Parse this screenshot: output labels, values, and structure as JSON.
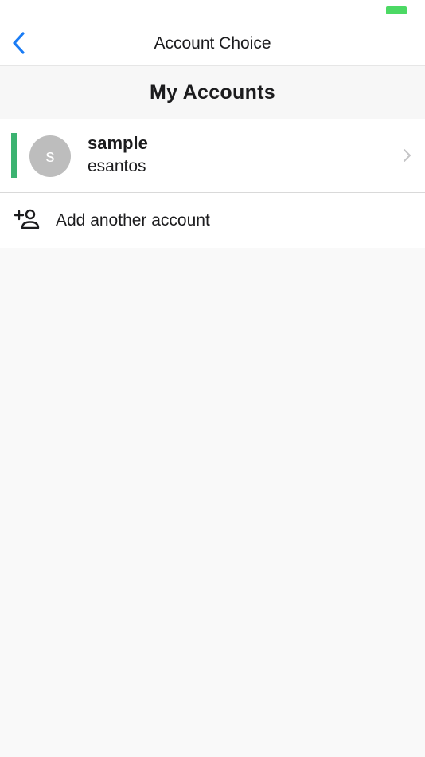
{
  "colors": {
    "accent": "#1a7cf5",
    "active_indicator": "#3cb371",
    "battery": "#4cd964"
  },
  "nav": {
    "title": "Account Choice",
    "back_icon": "chevron-left-icon"
  },
  "section": {
    "title": "My Accounts"
  },
  "accounts": [
    {
      "initial": "s",
      "name": "sample",
      "username": "esantos",
      "active": true
    }
  ],
  "add_account": {
    "label": "Add another account",
    "icon": "person-add-icon"
  }
}
